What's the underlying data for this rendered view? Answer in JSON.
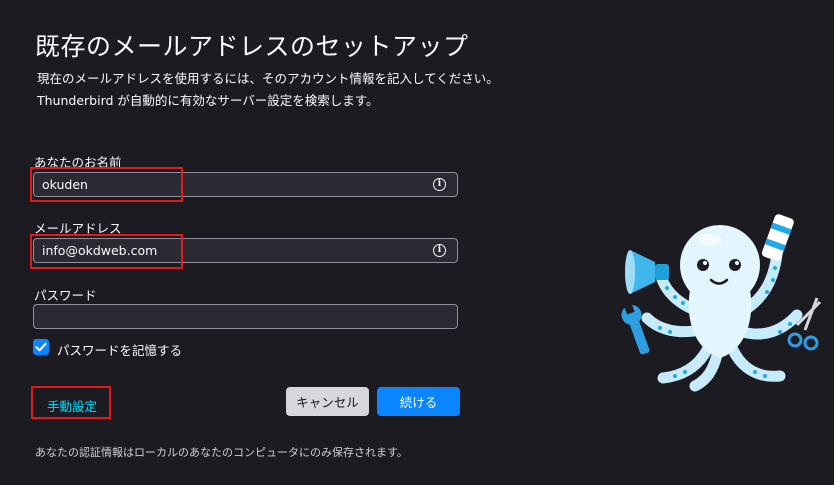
{
  "page": {
    "title": "既存のメールアドレスのセットアップ",
    "description_line1": "現在のメールアドレスを使用するには、そのアカウント情報を記入してください。",
    "description_line2": "Thunderbird が自動的に有効なサーバー設定を検索します。"
  },
  "form": {
    "name_label": "あなたのお名前",
    "name_value": "okuden",
    "email_label": "メールアドレス",
    "email_value": "info@okdweb.com",
    "password_label": "パスワード",
    "password_value": "",
    "remember_label": "パスワードを記憶する",
    "remember_checked": true
  },
  "actions": {
    "manual_label": "手動設定",
    "cancel_label": "キャンセル",
    "continue_label": "続ける"
  },
  "footer": {
    "note": "あなたの認証情報はローカルのあなたのコンピュータにのみ保存されます。"
  },
  "icons": {
    "info": "info-icon",
    "check": "checkmark-icon",
    "mascot": "octopus-mascot-illustration"
  },
  "colors": {
    "background": "#1c1b22",
    "accent": "#0a84ff",
    "link": "#00ddff",
    "highlight": "#e21a1a"
  }
}
